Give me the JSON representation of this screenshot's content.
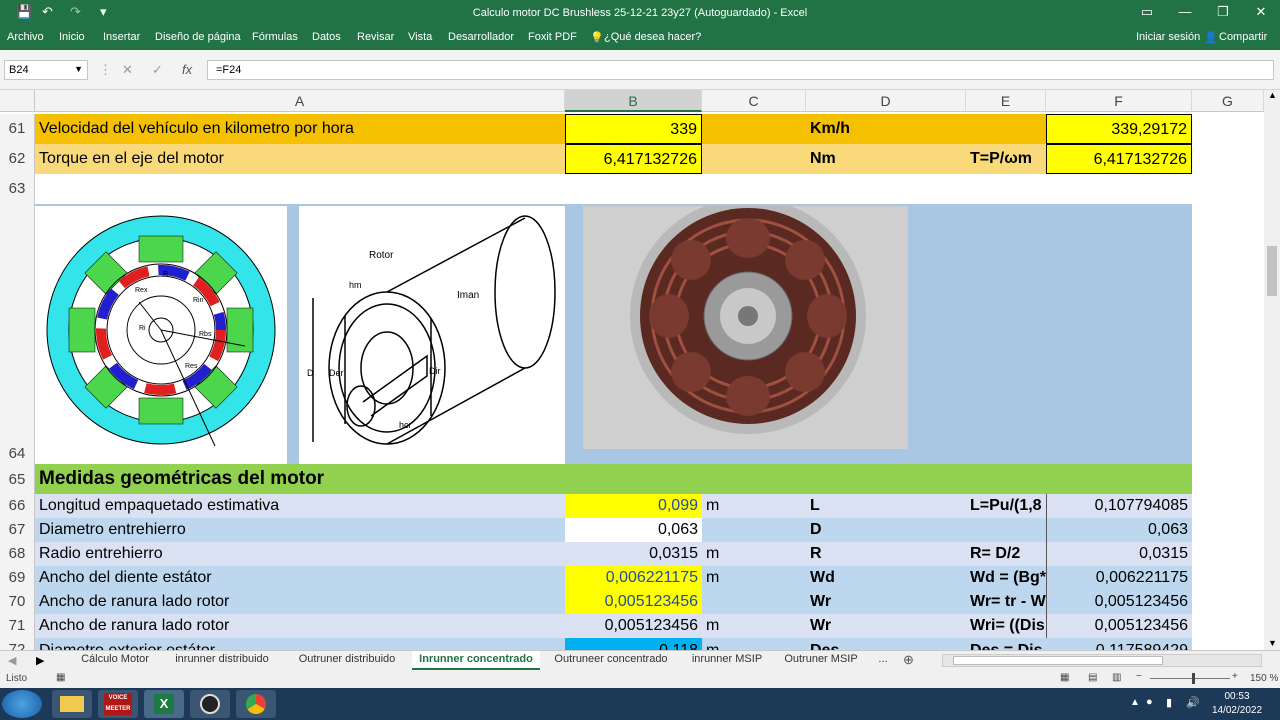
{
  "window": {
    "title": "Calculo motor DC Brushless 25-12-21 23y27 (Autoguardado) - Excel"
  },
  "ribbon": {
    "tabs": [
      "Archivo",
      "Inicio",
      "Insertar",
      "Diseño de página",
      "Fórmulas",
      "Datos",
      "Revisar",
      "Vista",
      "Desarrollador",
      "Foxit PDF",
      "¿Qué desea hacer?"
    ],
    "signin": "Iniciar sesión",
    "share": "Compartir"
  },
  "formula_bar": {
    "namebox": "B24",
    "formula": "=F24"
  },
  "columns": [
    "A",
    "B",
    "C",
    "D",
    "E",
    "F",
    "G"
  ],
  "rows": {
    "r61": {
      "num": "61",
      "a": "Velocidad del vehículo en kilometro por hora",
      "b": "339",
      "d": "Km/h",
      "f": "339,29172"
    },
    "r62": {
      "num": "62",
      "a": "Torque en el eje del motor",
      "b": "6,417132726",
      "d": "Nm",
      "e": "T=P/ωm",
      "f": "6,417132726"
    },
    "r63": {
      "num": "63"
    },
    "r64": {
      "num": "64"
    },
    "r65": {
      "num": "65",
      "a": "Medidas geométricas del motor"
    },
    "r66": {
      "num": "66",
      "a": "Longitud empaquetado estimativa",
      "b": "0,099",
      "c": "m",
      "d": "L",
      "e": "L=Pu/(1,8",
      "f": "0,107794085"
    },
    "r67": {
      "num": "67",
      "a": "Diametro entrehierro",
      "b": "0,063",
      "d": "D",
      "f": "0,063"
    },
    "r68": {
      "num": "68",
      "a": "Radio entrehierro",
      "b": "0,0315",
      "c": "m",
      "d": "R",
      "e": "R= D/2",
      "f": "0,0315"
    },
    "r69": {
      "num": "69",
      "a": "Ancho del diente estátor",
      "b": "0,006221175",
      "c": "m",
      "d": "Wd",
      "e": "Wd = (Bg*",
      "f": "0,006221175"
    },
    "r70": {
      "num": "70",
      "a": "Ancho de ranura lado rotor",
      "b": "0,005123456",
      "d": "Wr",
      "e": "Wr= tr - W",
      "f": "0,005123456"
    },
    "r71": {
      "num": "71",
      "a": "Ancho de ranura lado rotor",
      "b": "0,005123456",
      "c": "m",
      "d": "Wr",
      "e": "Wri= ((Dis",
      "f": "0,005123456"
    },
    "r72": {
      "num": "72",
      "a": "Diametro exterior estátor",
      "b": "0,118",
      "c": "m",
      "d": "Des",
      "e": "Des = Dis +",
      "f": "0,117589429"
    }
  },
  "diagram2": {
    "rotor": "Rotor",
    "iman": "Iman",
    "hm": "hm",
    "d": "D",
    "der": "Der",
    "dir": "Dir",
    "hcr": "hcr"
  },
  "diagram1": {
    "rex": "Rex",
    "r": "R",
    "rin": "Rin",
    "ri": "Ri",
    "rbs": "Rbs",
    "res": "Res"
  },
  "sheets": [
    "Cálculo Motor",
    "inrunner distribuido",
    "Outruner distribuido",
    "Inrunner concentrado",
    "Outruneer concentrado",
    "inrunner MSIP",
    "Outruner MSIP",
    "..."
  ],
  "status": {
    "ready": "Listo",
    "zoom": "150 %"
  },
  "taskbar": {
    "time": "00:53",
    "date": "14/02/2022",
    "voicemeeter": "VOICE MEETER"
  },
  "colors": {
    "excel_green": "#217346",
    "orange_row": "#f5c000",
    "light_orange": "#f9d97a",
    "yellow": "#ffff00",
    "blue_row": "#bdd7ee",
    "grey_row": "#d9e1f2",
    "green_header": "#92d050",
    "cyan_cell": "#00b0f0"
  }
}
